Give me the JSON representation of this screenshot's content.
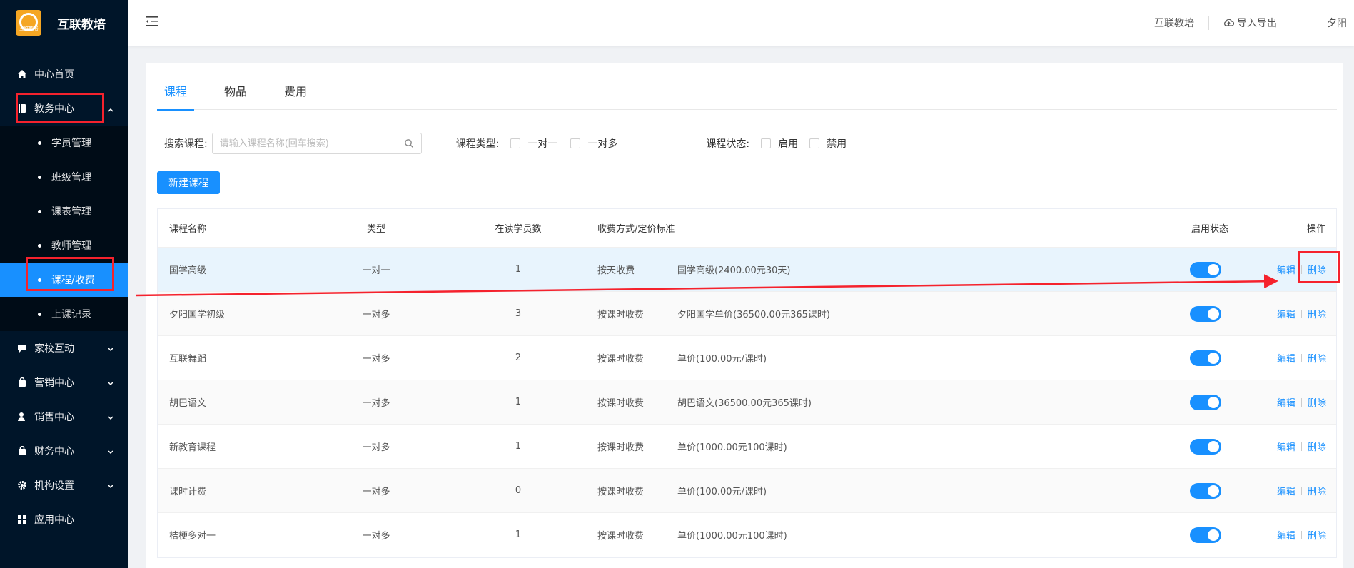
{
  "sidebar": {
    "brand_title": "互联教培",
    "logo_text": "互联教培",
    "items": [
      {
        "label": "中心首页",
        "icon": "home-icon"
      },
      {
        "label": "教务中心",
        "icon": "book-icon",
        "expanded": true
      },
      {
        "label": "家校互动",
        "icon": "chat-icon"
      },
      {
        "label": "营销中心",
        "icon": "bag-icon"
      },
      {
        "label": "销售中心",
        "icon": "user-icon"
      },
      {
        "label": "财务中心",
        "icon": "wallet-icon"
      },
      {
        "label": "机构设置",
        "icon": "gear-icon"
      },
      {
        "label": "应用中心",
        "icon": "grid-icon"
      }
    ],
    "sub_items": [
      {
        "label": "学员管理"
      },
      {
        "label": "班级管理"
      },
      {
        "label": "课表管理"
      },
      {
        "label": "教师管理"
      },
      {
        "label": "课程/收费",
        "active": true
      },
      {
        "label": "上课记录"
      }
    ]
  },
  "header": {
    "org_name": "互联教培",
    "export_label": "导入导出",
    "user_name": "夕阳"
  },
  "tabs": [
    {
      "label": "课程",
      "active": true
    },
    {
      "label": "物品"
    },
    {
      "label": "费用"
    }
  ],
  "filters": {
    "search_label": "搜索课程:",
    "search_placeholder": "请输入课程名称(回车搜索)",
    "type_label": "课程类型:",
    "type_options": [
      "一对一",
      "一对多"
    ],
    "status_label": "课程状态:",
    "status_options": [
      "启用",
      "禁用"
    ]
  },
  "new_button_label": "新建课程",
  "table": {
    "headers": {
      "name": "课程名称",
      "type": "类型",
      "count": "在读学员数",
      "pay": "收费方式/定价标准",
      "status": "启用状态",
      "op": "操作"
    },
    "edit_label": "编辑",
    "delete_label": "删除",
    "rows": [
      {
        "name": "国学高级",
        "type": "一对一",
        "count": "1",
        "pay": "按天收费",
        "price": "国学高级(2400.00元30天)",
        "enabled": true
      },
      {
        "name": "夕阳国学初级",
        "type": "一对多",
        "count": "3",
        "pay": "按课时收费",
        "price": "夕阳国学单价(36500.00元365课时)",
        "enabled": true
      },
      {
        "name": "互联舞蹈",
        "type": "一对多",
        "count": "2",
        "pay": "按课时收费",
        "price": "单价(100.00元/课时)",
        "enabled": true
      },
      {
        "name": "胡巴语文",
        "type": "一对多",
        "count": "1",
        "pay": "按课时收费",
        "price": "胡巴语文(36500.00元365课时)",
        "enabled": true
      },
      {
        "name": "新教育课程",
        "type": "一对多",
        "count": "1",
        "pay": "按课时收费",
        "price": "单价(1000.00元100课时)",
        "enabled": true
      },
      {
        "name": "课时计费",
        "type": "一对多",
        "count": "0",
        "pay": "按课时收费",
        "price": "单价(100.00元/课时)",
        "enabled": true
      },
      {
        "name": "桔梗多对一",
        "type": "一对多",
        "count": "1",
        "pay": "按课时收费",
        "price": "单价(1000.00元100课时)",
        "enabled": true
      }
    ]
  },
  "colors": {
    "sidebar_bg": "#001529",
    "accent": "#1890ff",
    "annotation": "#f5222d"
  }
}
